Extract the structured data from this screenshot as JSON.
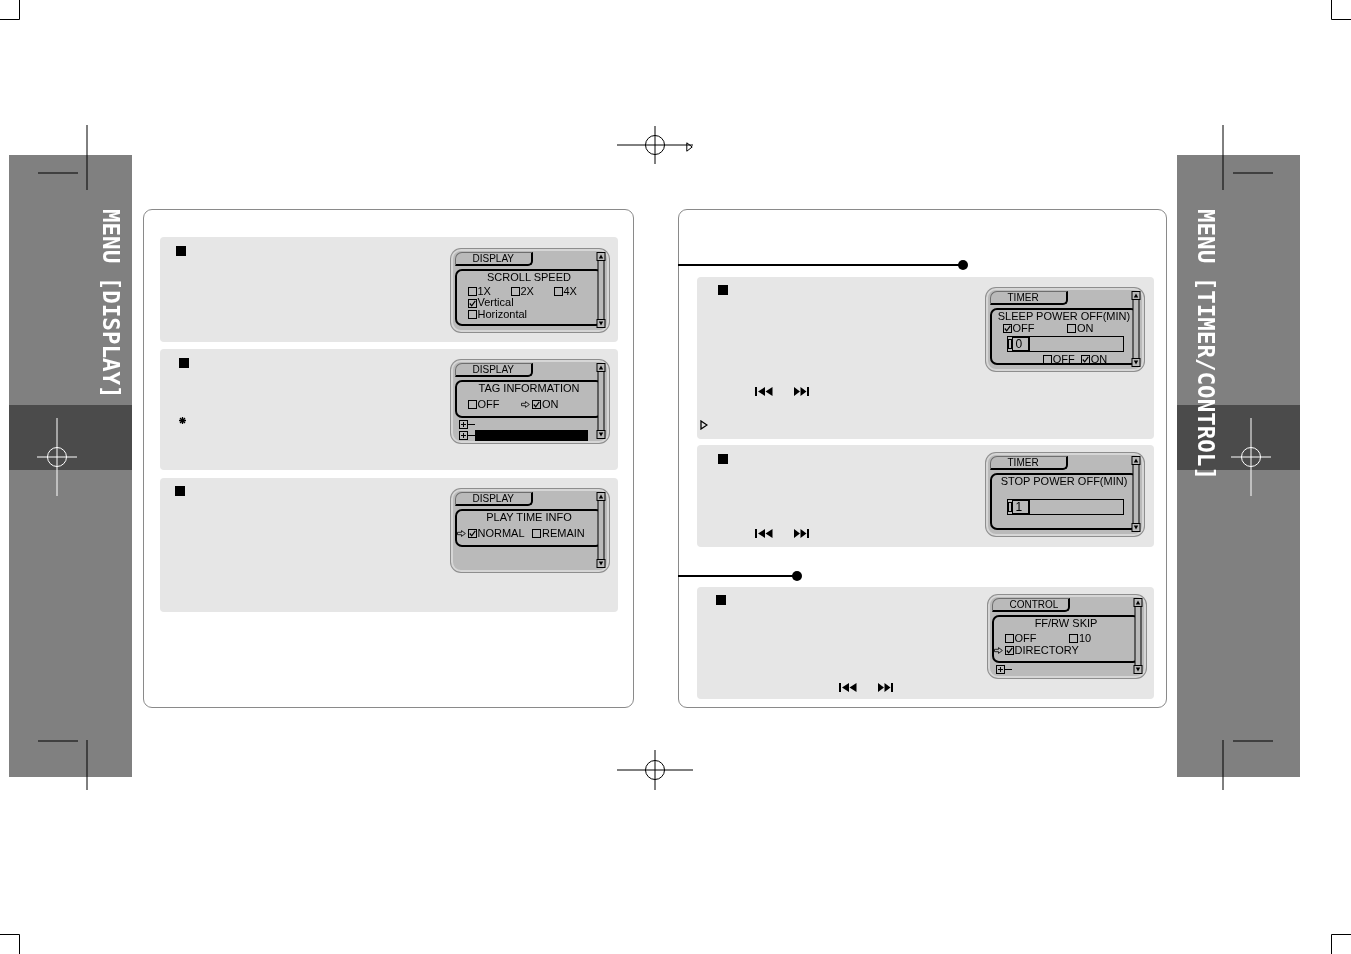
{
  "left_sidebar": {
    "label": "MENU [DISPLAY]"
  },
  "left_page": {
    "cards": [
      {
        "screen": {
          "tab": "DISPLAY",
          "title": "SCROLL SPEED",
          "rows": [
            {
              "kind": "options",
              "items": [
                {
                  "label": "1X",
                  "checked": false,
                  "pointed": false
                },
                {
                  "label": "2X",
                  "checked": false,
                  "pointed": false
                },
                {
                  "label": "4X",
                  "checked": false,
                  "pointed": false
                }
              ]
            },
            {
              "kind": "options",
              "items": [
                {
                  "label": "Vertical",
                  "checked": true,
                  "pointed": false
                }
              ]
            },
            {
              "kind": "options",
              "items": [
                {
                  "label": "Horizontal",
                  "checked": false,
                  "pointed": false
                }
              ]
            }
          ]
        }
      },
      {
        "marks": [
          {
            "kind": "asterisk"
          }
        ],
        "screen": {
          "tab": "DISPLAY",
          "title": "TAG INFORMATION",
          "rows": [
            {
              "kind": "options",
              "items": [
                {
                  "label": "OFF",
                  "checked": false,
                  "pointed": false
                },
                {
                  "label": "ON",
                  "checked": true,
                  "pointed": true
                }
              ]
            }
          ],
          "tree_items": [
            {
              "highlighted": false
            },
            {
              "highlighted": true
            }
          ]
        }
      },
      {
        "screen": {
          "tab": "DISPLAY",
          "title": "PLAY TIME INFO",
          "rows": [
            {
              "kind": "options",
              "items": [
                {
                  "label": "NORMAL",
                  "checked": true,
                  "pointed": true
                },
                {
                  "label": "REMAIN",
                  "checked": false,
                  "pointed": false
                }
              ]
            }
          ]
        }
      }
    ]
  },
  "right_page": {
    "groups": [
      {
        "cards": [
          {
            "marks": [
              {
                "kind": "skip_buttons"
              },
              {
                "kind": "play"
              }
            ],
            "screen": {
              "tab": "TIMER",
              "title": "SLEEP POWER OFF(MIN)",
              "rows": [
                {
                  "kind": "options",
                  "items": [
                    {
                      "label": "OFF",
                      "checked": true,
                      "pointed": false
                    },
                    {
                      "label": "ON",
                      "checked": false,
                      "pointed": false
                    }
                  ]
                },
                {
                  "kind": "slider",
                  "value": "0",
                  "level": 0
                },
                {
                  "kind": "toggle",
                  "items": [
                    {
                      "label": "OFF",
                      "checked": false,
                      "pointed": false
                    },
                    {
                      "label": "ON",
                      "checked": true,
                      "pointed": false
                    }
                  ]
                }
              ]
            }
          },
          {
            "marks": [
              {
                "kind": "skip_buttons"
              }
            ],
            "screen": {
              "tab": "TIMER",
              "title": "STOP POWER OFF(MIN)",
              "rows": [
                {
                  "kind": "slider",
                  "value": "1",
                  "level": 0
                }
              ]
            }
          }
        ]
      },
      {
        "cards": [
          {
            "marks": [
              {
                "kind": "skip_buttons"
              }
            ],
            "screen": {
              "tab": "CONTROL",
              "title": "FF/RW SKIP",
              "rows": [
                {
                  "kind": "options",
                  "items": [
                    {
                      "label": "OFF",
                      "checked": false,
                      "pointed": false
                    },
                    {
                      "label": "10",
                      "checked": false,
                      "pointed": false
                    }
                  ]
                },
                {
                  "kind": "options",
                  "items": [
                    {
                      "label": "DIRECTORY",
                      "checked": true,
                      "pointed": true
                    }
                  ]
                }
              ],
              "tree_items": [
                {
                  "highlighted": false
                }
              ]
            }
          }
        ]
      }
    ]
  },
  "right_sidebar": {
    "label": "MENU [TIMER/CONTROL]"
  }
}
